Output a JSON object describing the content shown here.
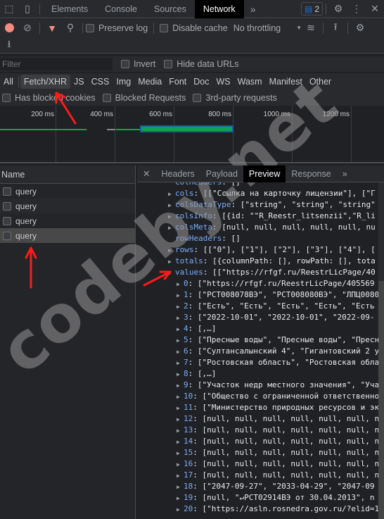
{
  "tabs": {
    "items": [
      "Elements",
      "Console",
      "Sources",
      "Network"
    ],
    "active": "Network",
    "issues_count": "2"
  },
  "toolbar": {
    "preserve_log": "Preserve log",
    "disable_cache": "Disable cache",
    "throttling": "No throttling"
  },
  "filter": {
    "placeholder": "Filter",
    "invert": "Invert",
    "hide_data_urls": "Hide data URLs"
  },
  "types": [
    "All",
    "Fetch/XHR",
    "JS",
    "CSS",
    "Img",
    "Media",
    "Font",
    "Doc",
    "WS",
    "Wasm",
    "Manifest",
    "Other"
  ],
  "selected_type": "Fetch/XHR",
  "checks": {
    "blocked_cookies": "Has blocked cookies",
    "blocked_requests": "Blocked Requests",
    "third_party": "3rd-party requests"
  },
  "timeline": {
    "ticks": [
      "200 ms",
      "400 ms",
      "600 ms",
      "800 ms",
      "1000 ms",
      "1200 ms"
    ]
  },
  "requests": {
    "header": "Name",
    "items": [
      "query",
      "query",
      "query",
      "query"
    ]
  },
  "panel": {
    "tabs": [
      "Headers",
      "Payload",
      "Preview",
      "Response"
    ],
    "active": "Preview"
  },
  "preview": [
    {
      "k": "colHeaders",
      "v": "[]",
      "t": ""
    },
    {
      "k": "cols",
      "v": "[[\"Ссылка на карточку лицензии\"], [\"Г",
      "t": "▶"
    },
    {
      "k": "colsDataType",
      "v": "[\"string\", \"string\", \"string\"",
      "t": "▶"
    },
    {
      "k": "colsInfo",
      "v": "[{id: \"\"R_Reestr_litsenzii\",\"R_li",
      "t": "▶"
    },
    {
      "k": "colsMeta",
      "v": "[null, null, null, null, null, nu",
      "t": "▶"
    },
    {
      "k": "rowHeaders",
      "v": "[]",
      "t": ""
    },
    {
      "k": "rows",
      "v": "[[\"0\"], [\"1\"], [\"2\"], [\"3\"], [\"4\"], [",
      "t": "▶"
    },
    {
      "k": "totals",
      "v": "[{columnPath: [], rowPath: [], tota",
      "t": "▶"
    },
    {
      "k": "values",
      "v": "[[\"https://rfgf.ru/ReestrLicPage/40",
      "t": "▼"
    }
  ],
  "values": [
    "[\"https://rfgf.ru/ReestrLicPage/405569",
    "[\"РСТ008078ВЭ\", \"РСТ008080ВЭ\", \"ЛПЦ0080",
    "[\"Есть\", \"Есть\", \"Есть\", \"Есть\", \"Есть",
    "[\"2022-10-01\", \"2022-10-01\", \"2022-09-",
    "[,…]",
    "[\"Пресные воды\", \"Пресные воды\", \"Пресн",
    "[\"Султансалынский 4\", \"Гигантовский 2 у",
    "[\"Ростовская область\", \"Ростовская обла",
    "[,…]",
    "[\"Участок недр местного значения\", \"Уча",
    "[\"Общество с ограниченной ответственно",
    "[\"Министерство природных ресурсов и эк",
    "[null, null, null, null, null, null, n",
    "[null, null, null, null, null, null, n",
    "[null, null, null, null, null, null, n",
    "[null, null, null, null, null, null, n",
    "[null, null, null, null, null, null, n",
    "[null, null, null, null, null, null, n",
    "[\"2047-09-27\", \"2033-04-29\", \"2047-09",
    "[null, \"↵РСТ02914ВЭ от 30.04.2013\", n",
    "[\"https://asln.rosnedra.gov.ru/?elid=1"
  ],
  "watermark": "codeby.net",
  "colors": {
    "record": "#f28b82",
    "filter_active": "#f28b82",
    "key": "#7cacf8",
    "bar_green": "#0ca54f",
    "bar_blue": "#1a73e8",
    "annotation": "#ff0000"
  }
}
